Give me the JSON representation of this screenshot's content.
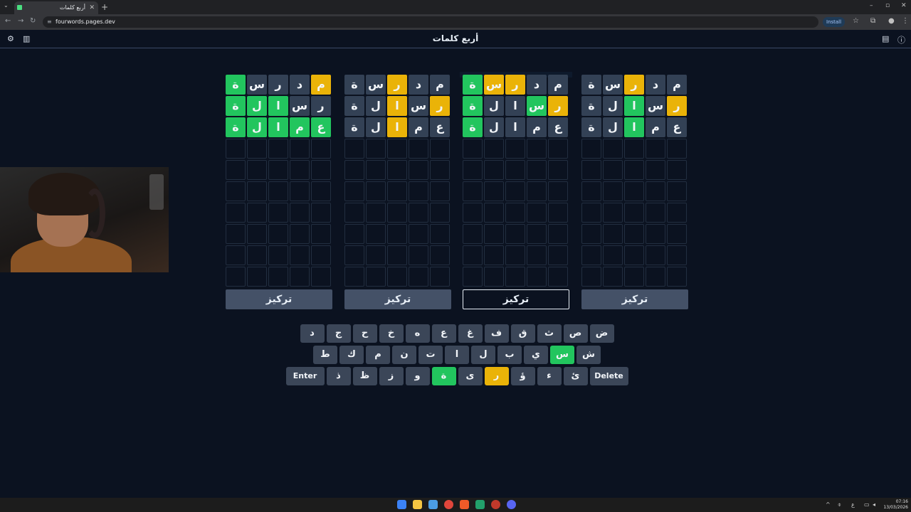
{
  "browser": {
    "tab_title": "أربع كلمات",
    "url": "fourwords.pages.dev",
    "install_label": "Install"
  },
  "app": {
    "title": "أربع كلمات",
    "focus_label": "تركيز"
  },
  "colors": {
    "green": "#22c55e",
    "yellow": "#eab308",
    "filled": "#334155",
    "empty_border": "#222e40",
    "background": "#0b1220"
  },
  "boards": [
    {
      "rows": [
        [
          [
            "م",
            "y"
          ],
          [
            "د",
            "f"
          ],
          [
            "ر",
            "f"
          ],
          [
            "س",
            "f"
          ],
          [
            "ة",
            "g"
          ]
        ],
        [
          [
            "ر",
            "f"
          ],
          [
            "س",
            "f"
          ],
          [
            "ا",
            "g"
          ],
          [
            "ل",
            "g"
          ],
          [
            "ة",
            "g"
          ]
        ],
        [
          [
            "ع",
            "g"
          ],
          [
            "م",
            "g"
          ],
          [
            "ا",
            "g"
          ],
          [
            "ل",
            "g"
          ],
          [
            "ة",
            "g"
          ]
        ]
      ]
    },
    {
      "rows": [
        [
          [
            "م",
            "f"
          ],
          [
            "د",
            "f"
          ],
          [
            "ر",
            "y"
          ],
          [
            "س",
            "f"
          ],
          [
            "ة",
            "f"
          ]
        ],
        [
          [
            "ر",
            "y"
          ],
          [
            "س",
            "f"
          ],
          [
            "ا",
            "y"
          ],
          [
            "ل",
            "f"
          ],
          [
            "ة",
            "f"
          ]
        ],
        [
          [
            "ع",
            "f"
          ],
          [
            "م",
            "f"
          ],
          [
            "ا",
            "y"
          ],
          [
            "ل",
            "f"
          ],
          [
            "ة",
            "f"
          ]
        ]
      ]
    },
    {
      "rows": [
        [
          [
            "م",
            "f"
          ],
          [
            "د",
            "f"
          ],
          [
            "ر",
            "y"
          ],
          [
            "س",
            "y"
          ],
          [
            "ة",
            "g"
          ]
        ],
        [
          [
            "ر",
            "y"
          ],
          [
            "س",
            "g"
          ],
          [
            "ا",
            "f"
          ],
          [
            "ل",
            "f"
          ],
          [
            "ة",
            "g"
          ]
        ],
        [
          [
            "ع",
            "f"
          ],
          [
            "م",
            "f"
          ],
          [
            "ا",
            "f"
          ],
          [
            "ل",
            "f"
          ],
          [
            "ة",
            "g"
          ]
        ]
      ]
    },
    {
      "rows": [
        [
          [
            "م",
            "f"
          ],
          [
            "د",
            "f"
          ],
          [
            "ر",
            "y"
          ],
          [
            "س",
            "f"
          ],
          [
            "ة",
            "f"
          ]
        ],
        [
          [
            "ر",
            "y"
          ],
          [
            "س",
            "f"
          ],
          [
            "ا",
            "g"
          ],
          [
            "ل",
            "f"
          ],
          [
            "ة",
            "f"
          ]
        ],
        [
          [
            "ع",
            "f"
          ],
          [
            "م",
            "f"
          ],
          [
            "ا",
            "g"
          ],
          [
            "ل",
            "f"
          ],
          [
            "ة",
            "f"
          ]
        ]
      ]
    }
  ],
  "keyboard": {
    "row1": [
      [
        "ض",
        ""
      ],
      [
        "ص",
        ""
      ],
      [
        "ث",
        ""
      ],
      [
        "ق",
        ""
      ],
      [
        "ف",
        ""
      ],
      [
        "غ",
        ""
      ],
      [
        "ع",
        ""
      ],
      [
        "ه",
        ""
      ],
      [
        "خ",
        ""
      ],
      [
        "ح",
        ""
      ],
      [
        "ج",
        ""
      ],
      [
        "د",
        ""
      ]
    ],
    "row2": [
      [
        "ش",
        ""
      ],
      [
        "س",
        "g"
      ],
      [
        "ي",
        ""
      ],
      [
        "ب",
        ""
      ],
      [
        "ل",
        ""
      ],
      [
        "ا",
        ""
      ],
      [
        "ت",
        ""
      ],
      [
        "ن",
        ""
      ],
      [
        "م",
        ""
      ],
      [
        "ك",
        ""
      ],
      [
        "ط",
        ""
      ]
    ],
    "row3": [
      [
        "Delete",
        "wide"
      ],
      [
        "ئ",
        ""
      ],
      [
        "ء",
        ""
      ],
      [
        "ؤ",
        ""
      ],
      [
        "ر",
        "y"
      ],
      [
        "ى",
        ""
      ],
      [
        "ة",
        "g"
      ],
      [
        "و",
        ""
      ],
      [
        "ز",
        ""
      ],
      [
        "ظ",
        ""
      ],
      [
        "ذ",
        ""
      ],
      [
        "Enter",
        "wide"
      ]
    ]
  },
  "taskbar": {
    "time": "07:16",
    "date": "13/03/2026"
  }
}
